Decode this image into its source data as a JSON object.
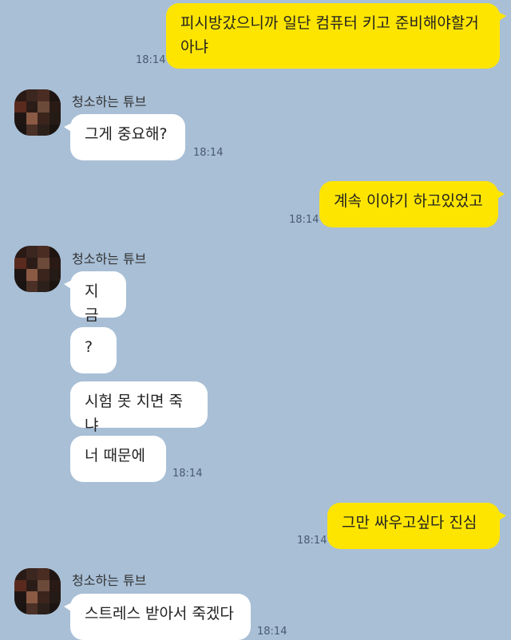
{
  "contact": {
    "name": "청소하는 튜브"
  },
  "messages": [
    {
      "from": "me",
      "text_line1": "피시방갔으니까 일단 컴퓨터 키고 준비해야할거",
      "text_line2": "아냐",
      "time": "18:14"
    },
    {
      "from": "them",
      "text": "그게 중요해?",
      "time": "18:14"
    },
    {
      "from": "me",
      "text": "계속 이야기 하고있었고",
      "time": "18:14"
    },
    {
      "from": "them",
      "text": "지금"
    },
    {
      "from": "them",
      "text": "?"
    },
    {
      "from": "them",
      "text": "시험 못 치면 죽냐"
    },
    {
      "from": "them",
      "text": "너 때문에",
      "time": "18:14"
    },
    {
      "from": "me",
      "text": "그만 싸우고싶다 진심",
      "time": "18:14"
    },
    {
      "from": "them",
      "text": "스트레스 받아서 죽겠다",
      "time": "18:14"
    }
  ],
  "colors": {
    "background": "#a8bfd6",
    "my_bubble": "#fee500",
    "their_bubble": "#ffffff"
  },
  "icons": {
    "avatar": "pixelated-profile-avatar"
  }
}
